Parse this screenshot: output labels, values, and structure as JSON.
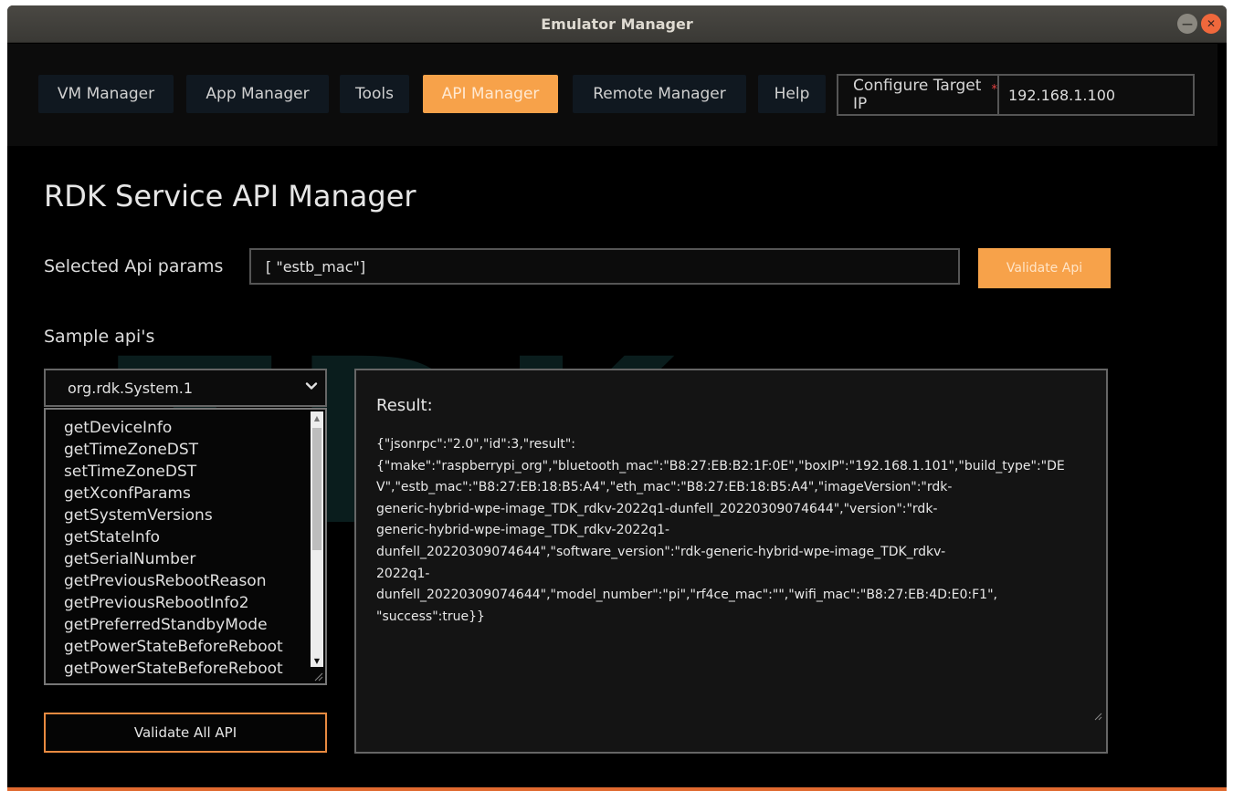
{
  "window": {
    "title": "Emulator Manager"
  },
  "nav": {
    "items": [
      {
        "label": "VM Manager",
        "active": false
      },
      {
        "label": "App Manager",
        "active": false
      },
      {
        "label": "Tools",
        "active": false
      },
      {
        "label": "API Manager",
        "active": true
      },
      {
        "label": "Remote Manager",
        "active": false
      },
      {
        "label": "Help",
        "active": false
      }
    ],
    "config_label": "Configure Target IP",
    "required_mark": "*",
    "target_ip": "192.168.1.100"
  },
  "page": {
    "title": "RDK Service API Manager",
    "params_label": "Selected Api params",
    "params_value": "[ \"estb_mac\"]",
    "validate_label": "Validate Api",
    "sample_label": "Sample api's",
    "selected_service": "org.rdk.System.1",
    "api_list": [
      "getDeviceInfo",
      "getTimeZoneDST",
      "setTimeZoneDST",
      "getXconfParams",
      "getSystemVersions",
      "getStateInfo",
      "getSerialNumber",
      "getPreviousRebootReason",
      "getPreviousRebootInfo2",
      "getPreferredStandbyMode",
      "getPowerStateBeforeReboot",
      "getPowerStateBeforeReboot"
    ],
    "validate_all_label": "Validate All API",
    "result_title": "Result:",
    "result_text": "{\"jsonrpc\":\"2.0\",\"id\":3,\"result\":\n{\"make\":\"raspberrypi_org\",\"bluetooth_mac\":\"B8:27:EB:B2:1F:0E\",\"boxIP\":\"192.168.1.101\",\"build_type\":\"DEV\",\"estb_mac\":\"B8:27:EB:18:B5:A4\",\"eth_mac\":\"B8:27:EB:18:B5:A4\",\"imageVersion\":\"rdk-\ngeneric-hybrid-wpe-image_TDK_rdkv-2022q1-dunfell_20220309074644\",\"version\":\"rdk-\ngeneric-hybrid-wpe-image_TDK_rdkv-2022q1-\ndunfell_20220309074644\",\"software_version\":\"rdk-generic-hybrid-wpe-image_TDK_rdkv-\n2022q1-\ndunfell_20220309074644\",\"model_number\":\"pi\",\"rf4ce_mac\":\"\",\"wifi_mac\":\"B8:27:EB:4D:E0:F1\",\n\"success\":true}}"
  },
  "colors": {
    "accent": "#f7a24a",
    "background": "#000000"
  }
}
